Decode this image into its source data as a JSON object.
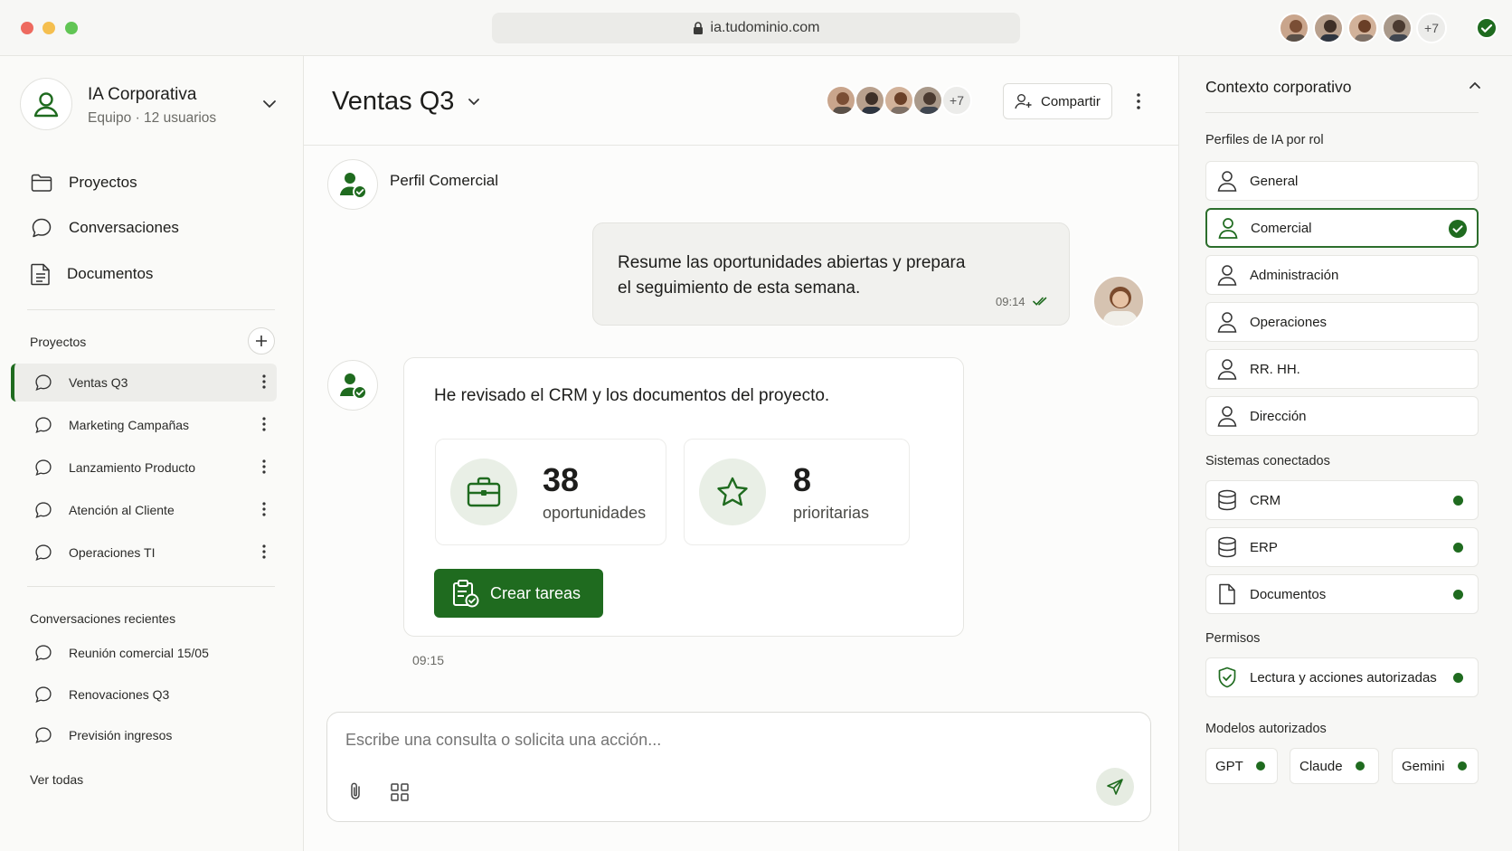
{
  "browser": {
    "url": "ia.tudominio.com",
    "extra_users": "+7"
  },
  "sidebar": {
    "org_name": "IA Corporativa",
    "org_subtitle": "Equipo · 12 usuarios",
    "nav": [
      {
        "label": "Proyectos",
        "icon": "folder-icon"
      },
      {
        "label": "Conversaciones",
        "icon": "chat-bubble-icon"
      },
      {
        "label": "Documentos",
        "icon": "document-icon"
      }
    ],
    "projects_title": "Proyectos",
    "projects": [
      {
        "label": "Ventas Q3",
        "active": true
      },
      {
        "label": "Marketing Campañas"
      },
      {
        "label": "Lanzamiento Producto"
      },
      {
        "label": "Atención al Cliente"
      },
      {
        "label": "Operaciones TI"
      }
    ],
    "recent_title": "Conversaciones recientes",
    "recent": [
      {
        "label": "Reunión comercial 15/05"
      },
      {
        "label": "Renovaciones Q3"
      },
      {
        "label": "Previsión ingresos"
      }
    ],
    "see_all": "Ver todas"
  },
  "main": {
    "title": "Ventas Q3",
    "extra_members": "+7",
    "share_label": "Compartir",
    "profile_label": "Perfil Comercial",
    "user_message_line1": "Resume las oportunidades abiertas y prepara",
    "user_message_line2": "el seguimiento de esta semana.",
    "user_message_time": "09:14",
    "reply_text": "He revisado el CRM y los documentos del proyecto.",
    "stats": [
      {
        "value": "38",
        "label": "oportunidades",
        "icon": "briefcase-icon"
      },
      {
        "value": "8",
        "label": "prioritarias",
        "icon": "star-icon"
      }
    ],
    "cta_label": "Crear tareas",
    "reply_time": "09:15",
    "composer_placeholder": "Escribe una consulta o solicita una acción..."
  },
  "context": {
    "title": "Contexto corporativo",
    "profiles_title": "Perfiles de IA por rol",
    "profiles": [
      {
        "label": "General"
      },
      {
        "label": "Comercial",
        "selected": true
      },
      {
        "label": "Administración"
      },
      {
        "label": "Operaciones"
      },
      {
        "label": "RR. HH."
      },
      {
        "label": "Dirección"
      }
    ],
    "systems_title": "Sistemas conectados",
    "systems": [
      {
        "label": "CRM",
        "icon": "database-icon"
      },
      {
        "label": "ERP",
        "icon": "database-icon"
      },
      {
        "label": "Documentos",
        "icon": "file-icon"
      }
    ],
    "permissions_title": "Permisos",
    "permission": "Lectura y acciones autorizadas",
    "models_title": "Modelos autorizados",
    "models": [
      "GPT",
      "Claude",
      "Gemini"
    ]
  },
  "colors": {
    "accent": "#1f6b1f",
    "status_ok": "#1f6b1f",
    "panel_bg": "#f7f7f5"
  }
}
